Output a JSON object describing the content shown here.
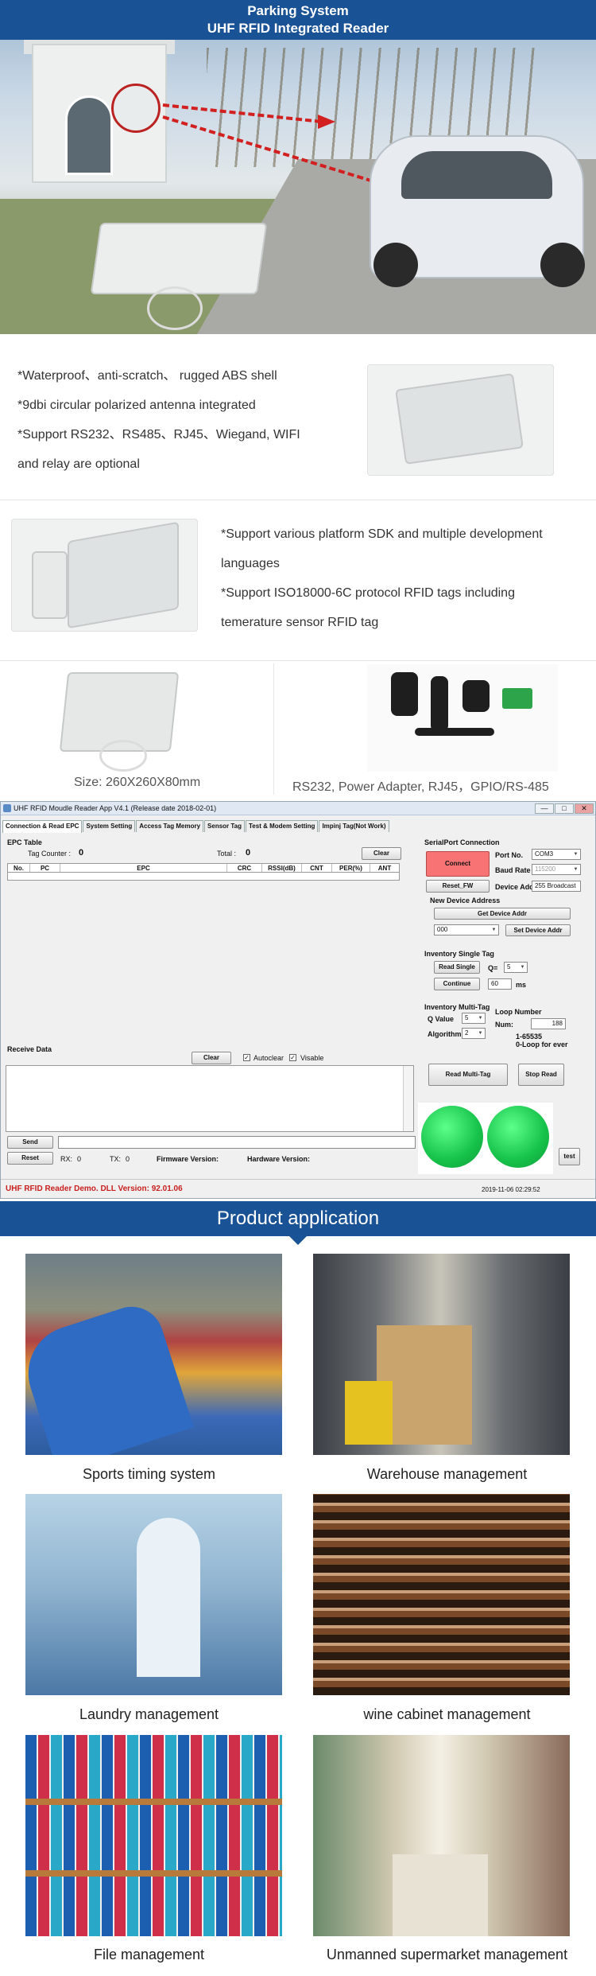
{
  "hero": {
    "title_line1": "Parking System",
    "title_line2": "UHF RFID Integrated Reader"
  },
  "features1": [
    "*Waterproof、anti-scratch、 rugged ABS shell",
    "*9dbi circular polarized antenna integrated",
    "*Support RS232、RS485、RJ45、Wiegand, WIFI",
    "and relay are optional"
  ],
  "features2": [
    "*Support various platform SDK and multiple development",
    "languages",
    "*Support ISO18000-6C protocol RFID tags including",
    "temerature sensor RFID tag"
  ],
  "size_caption": "Size: 260X260X80mm",
  "cable_caption": "RS232, Power Adapter, RJ45，GPIO/RS-485",
  "app_window": {
    "title": "UHF RFID Moudle Reader App V4.1 (Release date 2018-02-01)",
    "controls": {
      "min": "—",
      "max": "□",
      "close": "✕"
    },
    "tabs": [
      "Connection & Read EPC",
      "System Setting",
      "Access Tag Memory",
      "Sensor Tag",
      "Test & Modem Setting",
      "Impinj Tag(Not Work)"
    ],
    "epc_table_label": "EPC Table",
    "tag_counter_label": "Tag Counter :",
    "tag_counter_value": "0",
    "total_label": "Total :",
    "total_value": "0",
    "clear_label": "Clear",
    "columns": [
      "No.",
      "PC",
      "EPC",
      "CRC",
      "RSSI(dB)",
      "CNT",
      "PER(%)",
      "ANT"
    ],
    "receive_data_label": "Receive Data",
    "recv_clear_label": "Clear",
    "autoclear_label": "Autoclear",
    "visable_label": "Visable",
    "send_label": "Send",
    "reset_label": "Reset",
    "rx_label": "RX:",
    "rx_value": "0",
    "tx_label": "TX:",
    "tx_value": "0",
    "firmware_label": "Firmware Version:",
    "hardware_label": "Hardware Version:",
    "serial_group": "SerialPort Connection",
    "connect_label": "Connect",
    "port_no_label": "Port No.",
    "port_no_value": "COM3",
    "baud_label": "Baud Rate",
    "baud_value": "115200",
    "reset_fw_label": "Reset_FW",
    "device_addr_label": "Device Addr",
    "device_addr_value": "255 Broadcast",
    "new_device_group": "New Device Address",
    "get_device_addr_label": "Get Device Addr",
    "new_addr_value": "000",
    "set_device_addr_label": "Set Device Addr",
    "inv_single_group": "Inventory Single Tag",
    "read_single_label": "Read Single",
    "q_label": "Q=",
    "q_value": "5",
    "continue_label": "Continue",
    "continue_ms_value": "60",
    "ms_label": "ms",
    "inv_multi_group": "Inventory Multi-Tag",
    "q_value_label": "Q Value",
    "q_multi_value": "5",
    "algorithm_label": "Algorithm",
    "algorithm_value": "2",
    "loop_number_label": "Loop Number",
    "num_label": "Num:",
    "num_value": "188",
    "loop_range_1": "1-65535",
    "loop_range_2": "0-Loop for ever",
    "read_multi_label": "Read Multi-Tag",
    "stop_read_label": "Stop Read",
    "test_label": "test",
    "status_left": "UHF RFID Reader Demo. DLL Version: 92.01.06",
    "status_right": "2019-11-06 02:29:52",
    "connect_color": "#f87373",
    "led_color": "#22d45a"
  },
  "applications": {
    "title": "Product application",
    "items": [
      {
        "label": "Sports timing system"
      },
      {
        "label": "Warehouse management"
      },
      {
        "label": "Laundry management"
      },
      {
        "label": "wine cabinet management"
      },
      {
        "label": "File management"
      },
      {
        "label": "Unmanned supermarket management"
      }
    ]
  },
  "colors": {
    "brand_blue": "#1a5296",
    "accent_red": "#d21f1f"
  }
}
